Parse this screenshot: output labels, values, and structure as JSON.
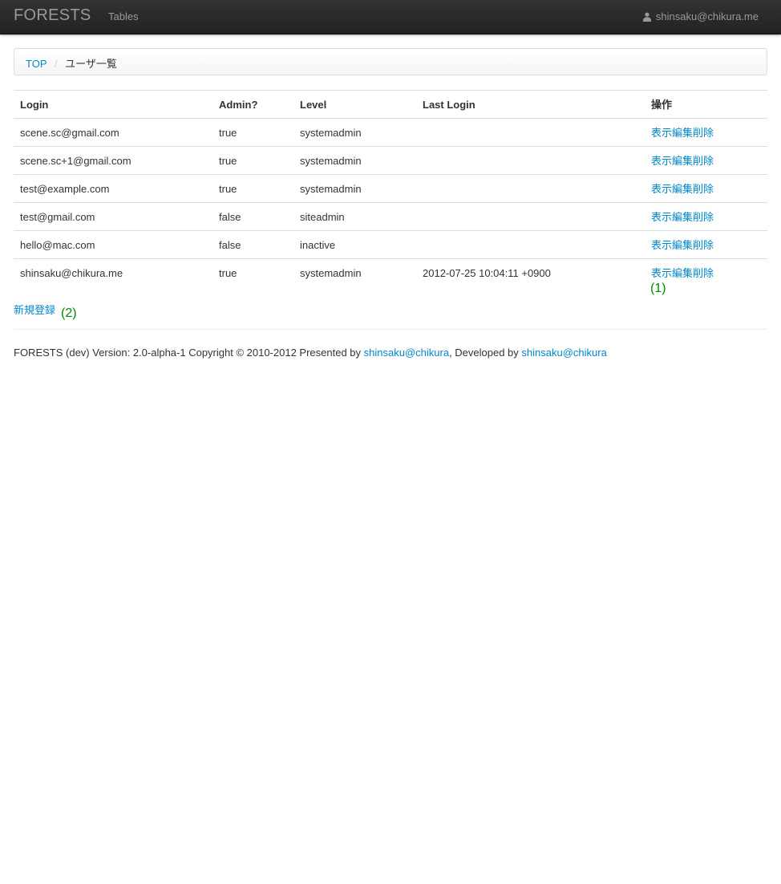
{
  "navbar": {
    "brand": "FORESTS",
    "tables_link": "Tables",
    "user_email": "shinsaku@chikura.me"
  },
  "breadcrumb": {
    "top": "TOP",
    "divider": "/",
    "current": "ユーザ一覧"
  },
  "table": {
    "headers": [
      "Login",
      "Admin?",
      "Level",
      "Last Login",
      "操作"
    ],
    "rows": [
      {
        "login": "scene.sc@gmail.com",
        "admin": "true",
        "level": "systemadmin",
        "last_login": "",
        "actions": [
          "表示",
          "編集",
          "削除"
        ]
      },
      {
        "login": "scene.sc+1@gmail.com",
        "admin": "true",
        "level": "systemadmin",
        "last_login": "",
        "actions": [
          "表示",
          "編集",
          "削除"
        ]
      },
      {
        "login": "test@example.com",
        "admin": "true",
        "level": "systemadmin",
        "last_login": "",
        "actions": [
          "表示",
          "編集",
          "削除"
        ]
      },
      {
        "login": "test@gmail.com",
        "admin": "false",
        "level": "siteadmin",
        "last_login": "",
        "actions": [
          "表示",
          "編集",
          "削除"
        ]
      },
      {
        "login": "hello@mac.com",
        "admin": "false",
        "level": "inactive",
        "last_login": "",
        "actions": [
          "表示",
          "編集",
          "削除"
        ]
      },
      {
        "login": "shinsaku@chikura.me",
        "admin": "true",
        "level": "systemadmin",
        "last_login": "2012-07-25 10:04:11 +0900",
        "actions": [
          "表示",
          "編集",
          "削除"
        ]
      }
    ]
  },
  "annotations": {
    "note1": "(1)",
    "note2": "(2)"
  },
  "new_link": "新規登録",
  "footer": {
    "text1": "FORESTS (dev) Version: 2.0-alpha-1 Copyright © 2010-2012 Presented by ",
    "link1": "shinsaku@chikura",
    "text2": ", Developed by ",
    "link2": "shinsaku@chikura"
  },
  "colors": {
    "link": "#0088cc",
    "navbar": "#222222",
    "annotation": "#008800"
  }
}
